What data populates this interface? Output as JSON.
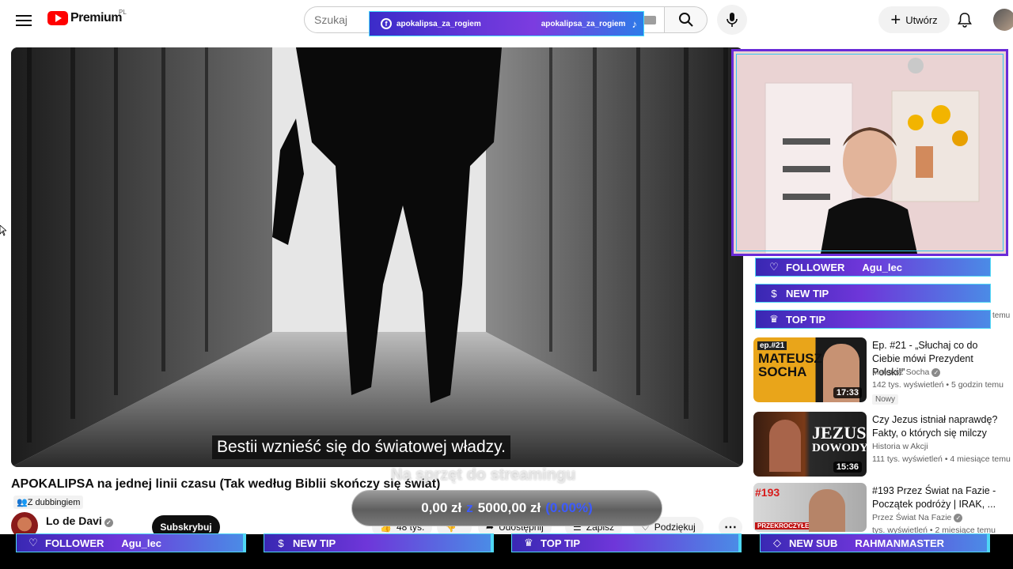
{
  "header": {
    "logo_text": "Premium",
    "logo_region": "PL",
    "search_placeholder": "Szukaj",
    "create_label": "Utwórz"
  },
  "social_banner": {
    "facebook": "apokalipsa_za_rogiem",
    "tiktok": "apokalipsa_za_rogiem"
  },
  "player": {
    "caption": "Bestii wznieść się do światowej władzy."
  },
  "video": {
    "title": "APOKALIPSA na jednej linii czasu (Tak według Biblii skończy się świat)",
    "dub_label": "Z dubbingiem",
    "channel": "Lo de Davi",
    "subscribe_label": "Subskrybuj",
    "likes": "48 tys.",
    "share_label": "Udostępnij",
    "save_label": "Zapisz",
    "thanks_label": "Podziękuj"
  },
  "donation_goal": {
    "label": "Na sprzęt do streamingu",
    "current": "0,00 zł",
    "separator": "z",
    "target": "5000,00 zł",
    "percent": "(0.00%)",
    "progress": 0
  },
  "side_alerts": [
    {
      "type": "FOLLOWER",
      "icon": "heart",
      "name": "Agu_lec"
    },
    {
      "type": "NEW TIP",
      "icon": "dollar",
      "name": ""
    },
    {
      "type": "TOP TIP",
      "icon": "crown",
      "name": ""
    }
  ],
  "side_ago": "temu",
  "recommended": [
    {
      "title": "Ep. #21 - „Słuchaj co do Ciebie mówi Prezydent Polski!\"",
      "channel": "Mateusz Socha",
      "meta": "142 tys. wyświetleń • 5 godzin temu",
      "badge": "Nowy",
      "duration": "17:33",
      "thumb_top": "ep.#21",
      "thumb_main": "MATEUSZ SOCHA"
    },
    {
      "title": "Czy Jezus istniał naprawdę? Fakty, o których się milczy",
      "channel": "Historia w Akcji",
      "meta": "111 tys. wyświetleń • 4 miesiące temu",
      "badge": "",
      "duration": "15:36",
      "thumb_top": "JEZUS",
      "thumb_main": "DOWODY"
    },
    {
      "title": "#193 Przez Świat na Fazie - Początek podróży | IRAK, ...",
      "channel": "Przez Świat Na Fazie",
      "meta": "tys. wyświetleń • 2 miesiące temu",
      "badge": "",
      "duration": "",
      "thumb_top": "#193",
      "thumb_main": "PRZEKROCZYŁEM"
    }
  ],
  "bottom_alerts": [
    {
      "type": "FOLLOWER",
      "icon": "heart",
      "name": "Agu_lec"
    },
    {
      "type": "NEW TIP",
      "icon": "dollar",
      "name": ""
    },
    {
      "type": "TOP TIP",
      "icon": "crown",
      "name": ""
    },
    {
      "type": "NEW SUB",
      "icon": "diamond",
      "name": "RAHMANMASTER"
    }
  ],
  "colors": {
    "alert_start": "#3928b3",
    "alert_mid": "#6e36d9",
    "alert_end": "#4b8be6",
    "alert_border": "#4fd7f5",
    "youtube_red": "#ff0000",
    "goal_accent": "#3d5bff"
  }
}
